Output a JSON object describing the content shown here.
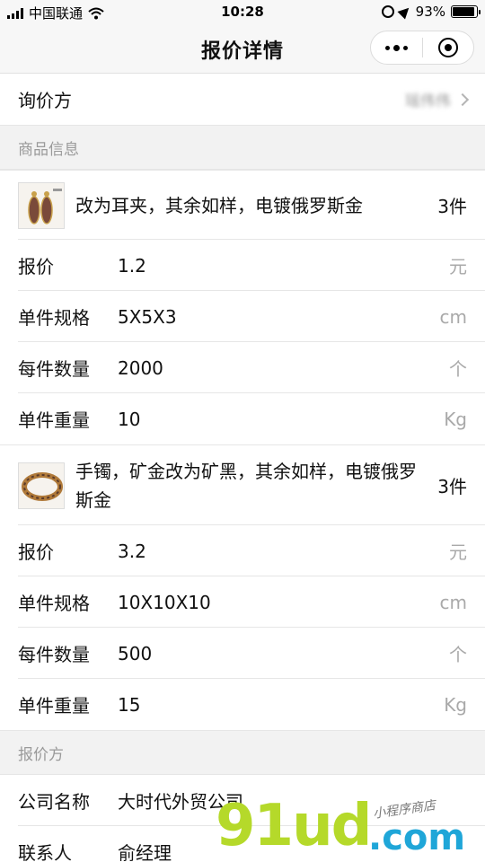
{
  "status_bar": {
    "carrier": "中国联通",
    "time": "10:28",
    "battery": "93%",
    "battery_level": 0.93
  },
  "nav": {
    "title": "报价详情",
    "more_icon": "more-dots-icon",
    "close_icon": "target-icon"
  },
  "inquirer": {
    "label": "询价方",
    "value": "瑶伟伟"
  },
  "goods_section": {
    "title": "商品信息"
  },
  "products": [
    {
      "name": "改为耳夹，其余如样，电镀俄罗斯金",
      "qty": "3件",
      "fields": [
        {
          "label": "报价",
          "value": "1.2",
          "unit": "元"
        },
        {
          "label": "单件规格",
          "value": "5X5X3",
          "unit": "cm"
        },
        {
          "label": "每件数量",
          "value": "2000",
          "unit": "个"
        },
        {
          "label": "单件重量",
          "value": "10",
          "unit": "Kg"
        }
      ]
    },
    {
      "name": "手镯，矿金改为矿黑，其余如样，电镀俄罗斯金",
      "qty": "3件",
      "fields": [
        {
          "label": "报价",
          "value": "3.2",
          "unit": "元"
        },
        {
          "label": "单件规格",
          "value": "10X10X10",
          "unit": "cm"
        },
        {
          "label": "每件数量",
          "value": "500",
          "unit": "个"
        },
        {
          "label": "单件重量",
          "value": "15",
          "unit": "Kg"
        }
      ]
    }
  ],
  "quoter_section": {
    "title": "报价方"
  },
  "quoter": [
    {
      "label": "公司名称",
      "value": "大时代外贸公司"
    },
    {
      "label": "联系人",
      "value": "俞经理"
    }
  ],
  "watermark": {
    "main": "91ud",
    "suffix": ".com",
    "tagline": "小程序商店"
  }
}
